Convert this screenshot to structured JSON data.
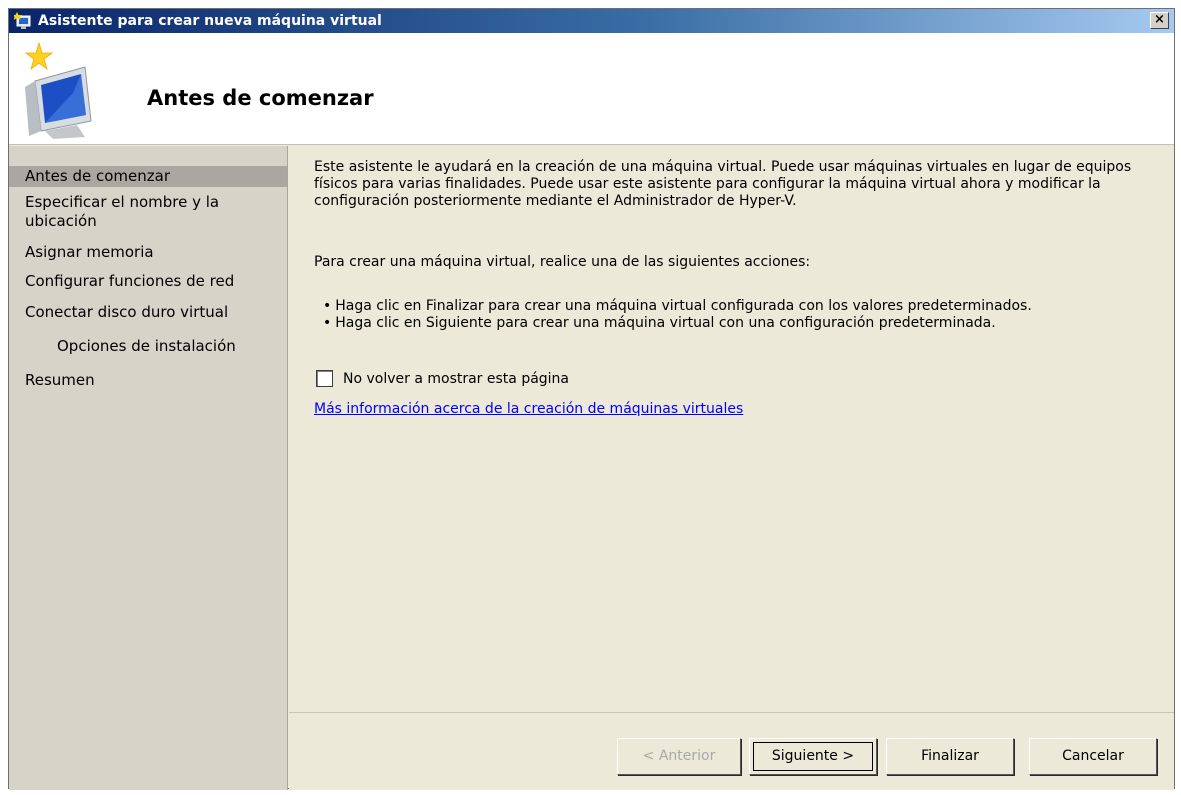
{
  "window": {
    "title": "Asistente para crear nueva máquina virtual",
    "close_label": "×"
  },
  "header": {
    "title": "Antes de comenzar"
  },
  "sidebar": {
    "items": [
      {
        "label": "Antes de comenzar"
      },
      {
        "label": "Especificar el nombre y la ubicación"
      },
      {
        "label": "Asignar memoria"
      },
      {
        "label": "Configurar funciones de red"
      },
      {
        "label": "Conectar disco duro virtual"
      },
      {
        "label": "Opciones de instalación"
      },
      {
        "label": "Resumen"
      }
    ]
  },
  "content": {
    "intro": "Este asistente le ayudará en la creación de una máquina virtual. Puede usar máquinas virtuales en lugar de equipos físicos para varias finalidades. Puede usar este asistente para configurar la máquina virtual ahora y modificar la configuración posteriormente mediante el Administrador de Hyper-V.",
    "instruction": "Para crear una máquina virtual, realice una de las siguientes acciones:",
    "bullets": [
      "Haga clic en Finalizar para crear una máquina virtual configurada con los valores predeterminados.",
      "Haga clic en Siguiente para crear una máquina virtual con una configuración predeterminada."
    ],
    "checkbox_label": "No volver a mostrar esta página",
    "help_link": "Más información acerca de la creación de máquinas virtuales"
  },
  "buttons": {
    "back": "< Anterior",
    "next": "Siguiente >",
    "finish": "Finalizar",
    "cancel": "Cancelar"
  },
  "colors": {
    "titlebar_start": "#0a246a",
    "titlebar_end": "#a6caf0",
    "link": "#0000ff",
    "sidebar_bg": "#d6d3c9",
    "active_item_bg": "#a9a7a0"
  }
}
